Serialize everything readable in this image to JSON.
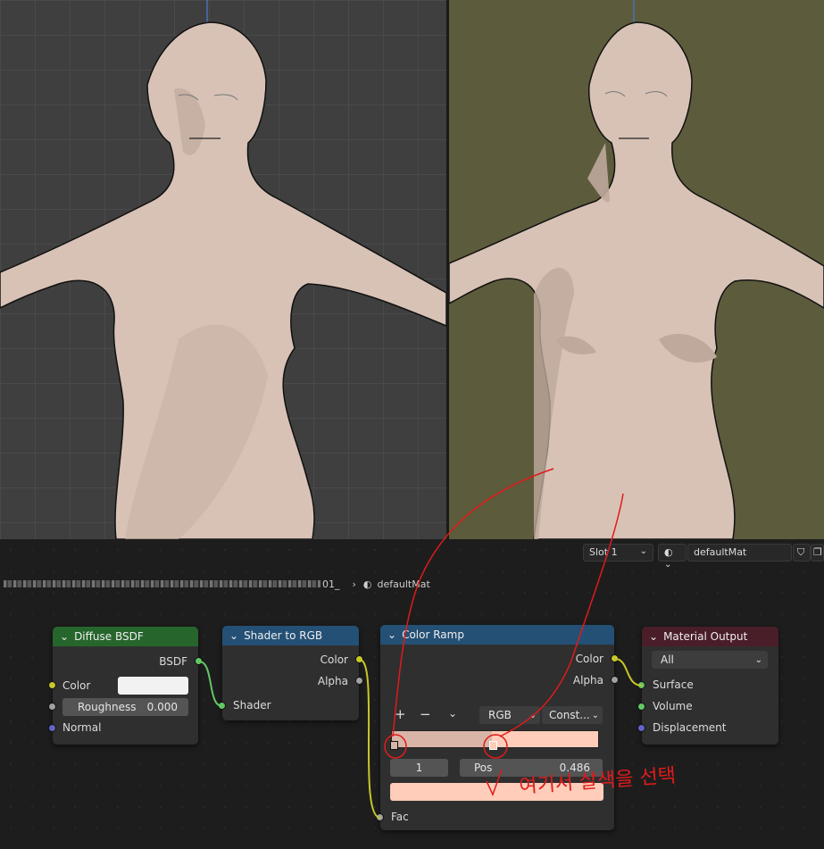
{
  "header": {
    "slot_label": "Slot 1",
    "material_name": "defaultMat"
  },
  "breadcrumb": {
    "object_name": "01_",
    "material_name": "defaultMat"
  },
  "nodes": {
    "diffuse": {
      "title": "Diffuse BSDF",
      "output_bsdf": "BSDF",
      "input_color": "Color",
      "input_roughness": "Roughness",
      "roughness_value": "0.000",
      "input_normal": "Normal",
      "color_swatch": "#f2f2f2"
    },
    "shader_to_rgb": {
      "title": "Shader to RGB",
      "output_color": "Color",
      "output_alpha": "Alpha",
      "input_shader": "Shader"
    },
    "color_ramp": {
      "title": "Color Ramp",
      "output_color": "Color",
      "output_alpha": "Alpha",
      "add_label": "+",
      "remove_label": "−",
      "color_mode": "RGB",
      "interpolation": "Const...",
      "stop_index": "1",
      "pos_label": "Pos",
      "pos_value": "0.486",
      "input_fac": "Fac",
      "ramp_color_left": "#d9b5a7",
      "ramp_color_right": "#ffcdb9",
      "selected_color": "#ffcdb9"
    },
    "material_output": {
      "title": "Material Output",
      "target": "All",
      "input_surface": "Surface",
      "input_volume": "Volume",
      "input_displacement": "Displacement"
    }
  },
  "annotation": {
    "handwritten_text": "여기서 살색을 선택"
  },
  "colors": {
    "diffuse_header": "#26662d",
    "converter_header": "#245075",
    "output_header": "#4a1e29",
    "annotation_red": "#e01b1b",
    "skin": "#d8c2b6",
    "skin_shadow": "#bfa99c",
    "right_viewport_bg": "#5c5b3c",
    "left_viewport_bg": "#3f3f3f"
  }
}
